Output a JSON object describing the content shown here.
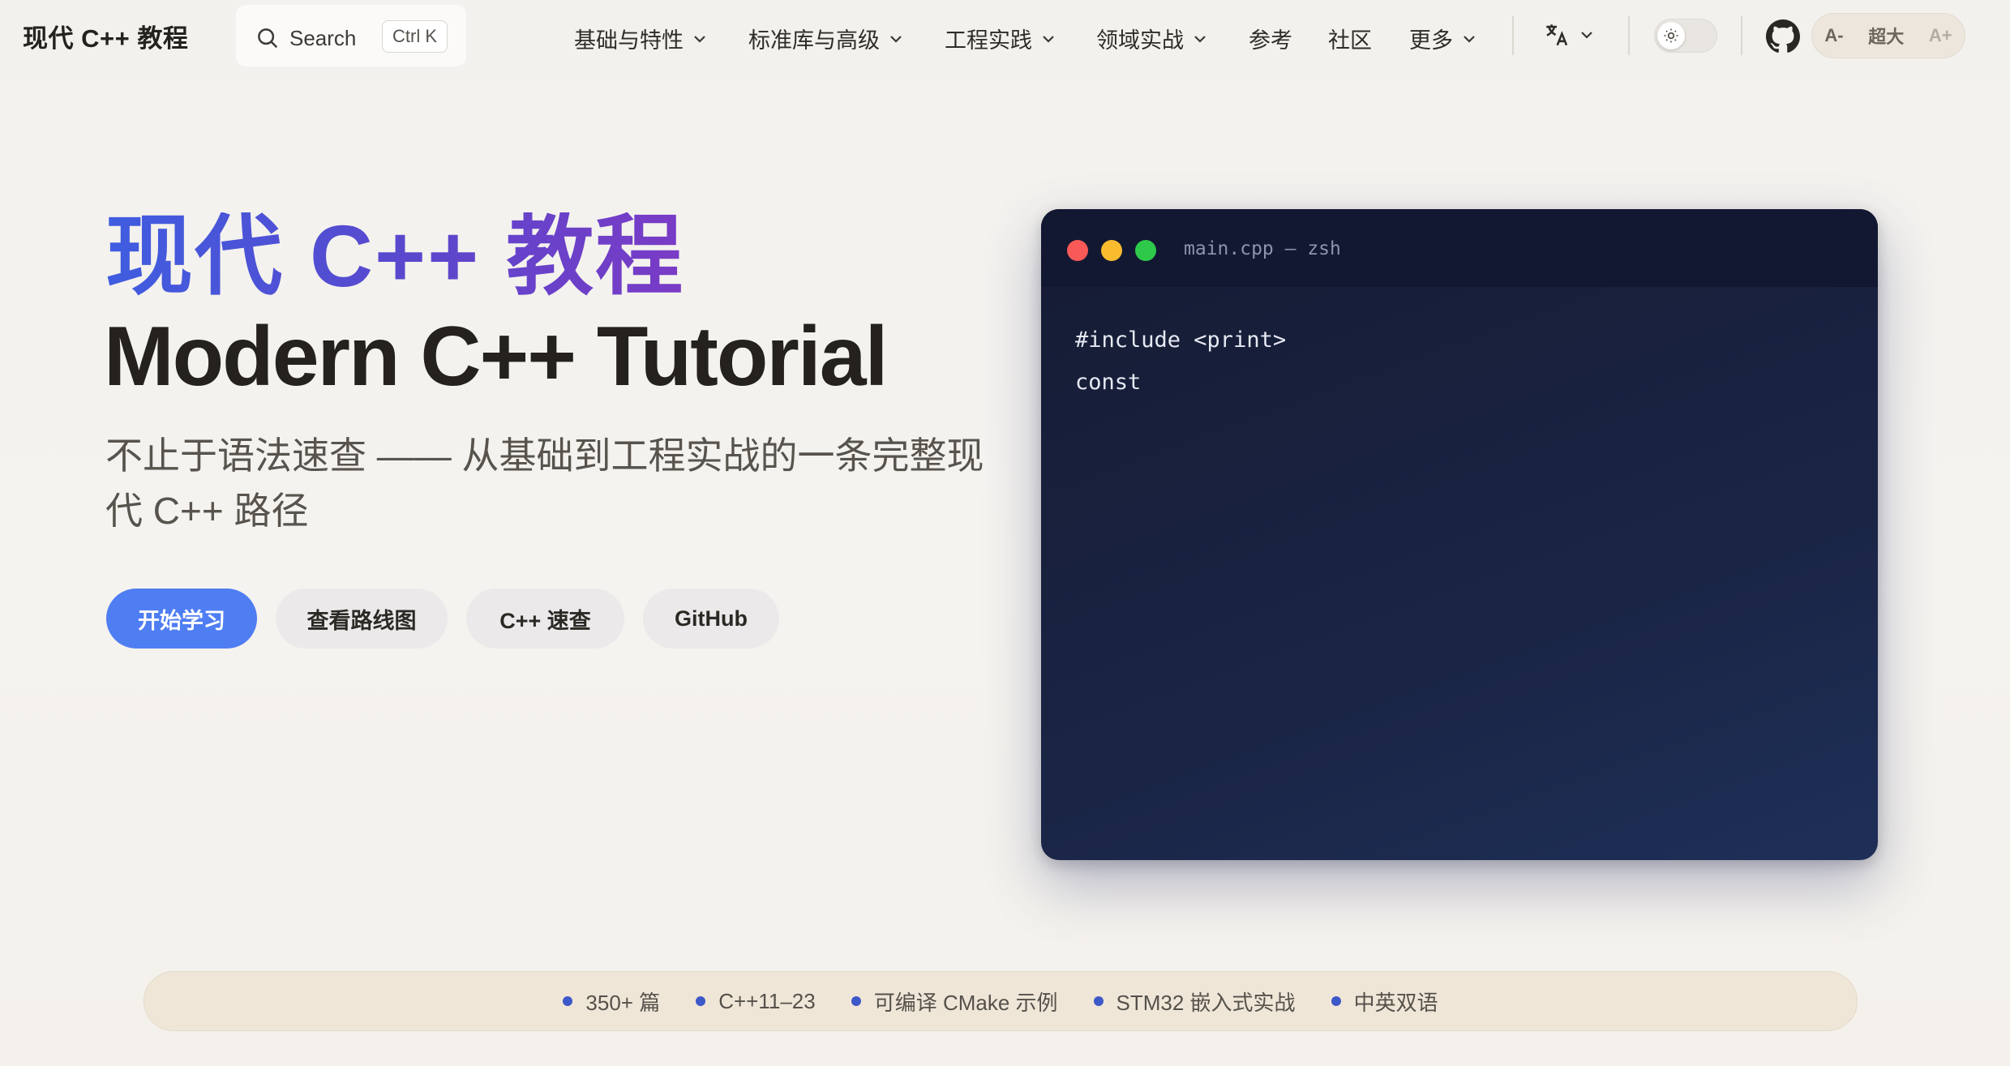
{
  "nav": {
    "brand": "现代 C++ 教程",
    "search": {
      "label": "Search",
      "shortcut": "Ctrl K"
    },
    "menu": [
      {
        "label": "基础与特性",
        "dropdown": true
      },
      {
        "label": "标准库与高级",
        "dropdown": true
      },
      {
        "label": "工程实践",
        "dropdown": true
      },
      {
        "label": "领域实战",
        "dropdown": true
      },
      {
        "label": "参考",
        "dropdown": false
      },
      {
        "label": "社区",
        "dropdown": false
      },
      {
        "label": "更多",
        "dropdown": true
      }
    ],
    "language_icon": "translate-icon",
    "theme_toggle_icon": "sun-icon",
    "github_icon": "github-icon",
    "font_size": {
      "decrease": "A-",
      "current": "超大",
      "increase": "A+"
    }
  },
  "hero": {
    "title_cn": "现代 C++ 教程",
    "title_en": "Modern C++ Tutorial",
    "subtitle": "不止于语法速查 —— 从基础到工程实战的一条完整现代 C++ 路径",
    "buttons": [
      {
        "label": "开始学习",
        "primary": true
      },
      {
        "label": "查看路线图",
        "primary": false
      },
      {
        "label": "C++ 速查",
        "primary": false
      },
      {
        "label": "GitHub",
        "primary": false
      }
    ]
  },
  "code_window": {
    "title": "main.cpp — zsh",
    "lines": [
      "#include <print>",
      "const"
    ]
  },
  "stats": [
    "350+ 篇",
    "C++11–23",
    "可编译 CMake 示例",
    "STM32 嵌入式实战",
    "中英双语"
  ],
  "colors": {
    "accent": "#4f7df2",
    "title_gradient_start": "#3f5de0",
    "title_gradient_end": "#7a3bc6",
    "code_bg": "#1a2444",
    "stat_bullet": "#3d58c8"
  }
}
